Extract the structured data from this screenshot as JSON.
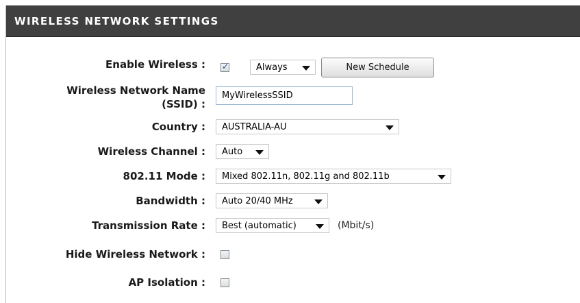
{
  "header": {
    "title": "WIRELESS NETWORK SETTINGS"
  },
  "enable_wireless": {
    "label": "Enable Wireless :",
    "checked": true,
    "schedule_value": "Always",
    "new_schedule_label": "New Schedule"
  },
  "ssid": {
    "label_line1": "Wireless Network Name",
    "label_line2": "(SSID) :",
    "value": "MyWirelessSSID"
  },
  "country": {
    "label": "Country :",
    "value": "AUSTRALIA-AU"
  },
  "channel": {
    "label": "Wireless Channel :",
    "value": "Auto"
  },
  "mode": {
    "label": "802.11 Mode :",
    "value": "Mixed 802.11n, 802.11g and 802.11b"
  },
  "bandwidth": {
    "label": "Bandwidth :",
    "value": "Auto 20/40 MHz"
  },
  "tx_rate": {
    "label": "Transmission Rate :",
    "value": "Best (automatic)",
    "unit": "(Mbit/s)"
  },
  "hide_network": {
    "label": "Hide Wireless Network :",
    "checked": false
  },
  "ap_isolation": {
    "label": "AP Isolation :",
    "checked": false
  },
  "colors": {
    "header_bg": "#404040",
    "header_text": "#ffffff",
    "label_text": "#1a1a1a"
  }
}
